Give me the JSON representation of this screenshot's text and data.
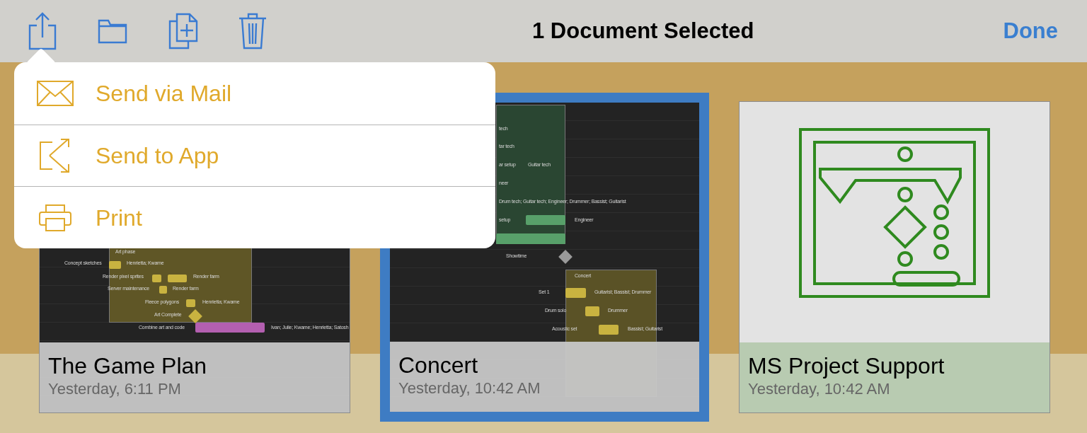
{
  "toolbar": {
    "title": "1 Document Selected",
    "done": "Done"
  },
  "share_menu": {
    "items": [
      {
        "kind": "mail",
        "label": "Send via Mail"
      },
      {
        "kind": "app",
        "label": "Send to App"
      },
      {
        "kind": "print",
        "label": "Print"
      }
    ]
  },
  "documents": [
    {
      "title": "The Game Plan",
      "date": "Yesterday, 6:11 PM",
      "selected": false,
      "kind": "gantt-game",
      "labels": [
        "Art phase",
        "Concept sketches",
        "Henrietta; Kwame",
        "Render pixel sprites",
        "Render farm",
        "Server maintenance",
        "Render farm",
        "Fleece polygons",
        "Henrietta; Kwame",
        "Art Complete",
        "Combine art and code",
        "Ivan; Julie; Kwame; Henrietta; Satosh"
      ]
    },
    {
      "title": "Concert",
      "date": "Yesterday, 10:42 AM",
      "selected": true,
      "kind": "gantt-concert",
      "labels": [
        "tech",
        "tar tech",
        "ar setup",
        "Guitar tech",
        "neer",
        "Drum tech; Guitar tech; Engineer; Drummer; Bassist; Guitarist",
        "setup",
        "Engineer",
        "Showtime",
        "Concert",
        "Set 1",
        "Guitarist; Bassist; Drummer",
        "Drum solo",
        "Drummer",
        "Acoustic set",
        "Bassist; Guitarist"
      ]
    },
    {
      "title": "MS Project Support",
      "date": "Yesterday, 10:42 AM",
      "selected": false,
      "kind": "icon"
    }
  ]
}
